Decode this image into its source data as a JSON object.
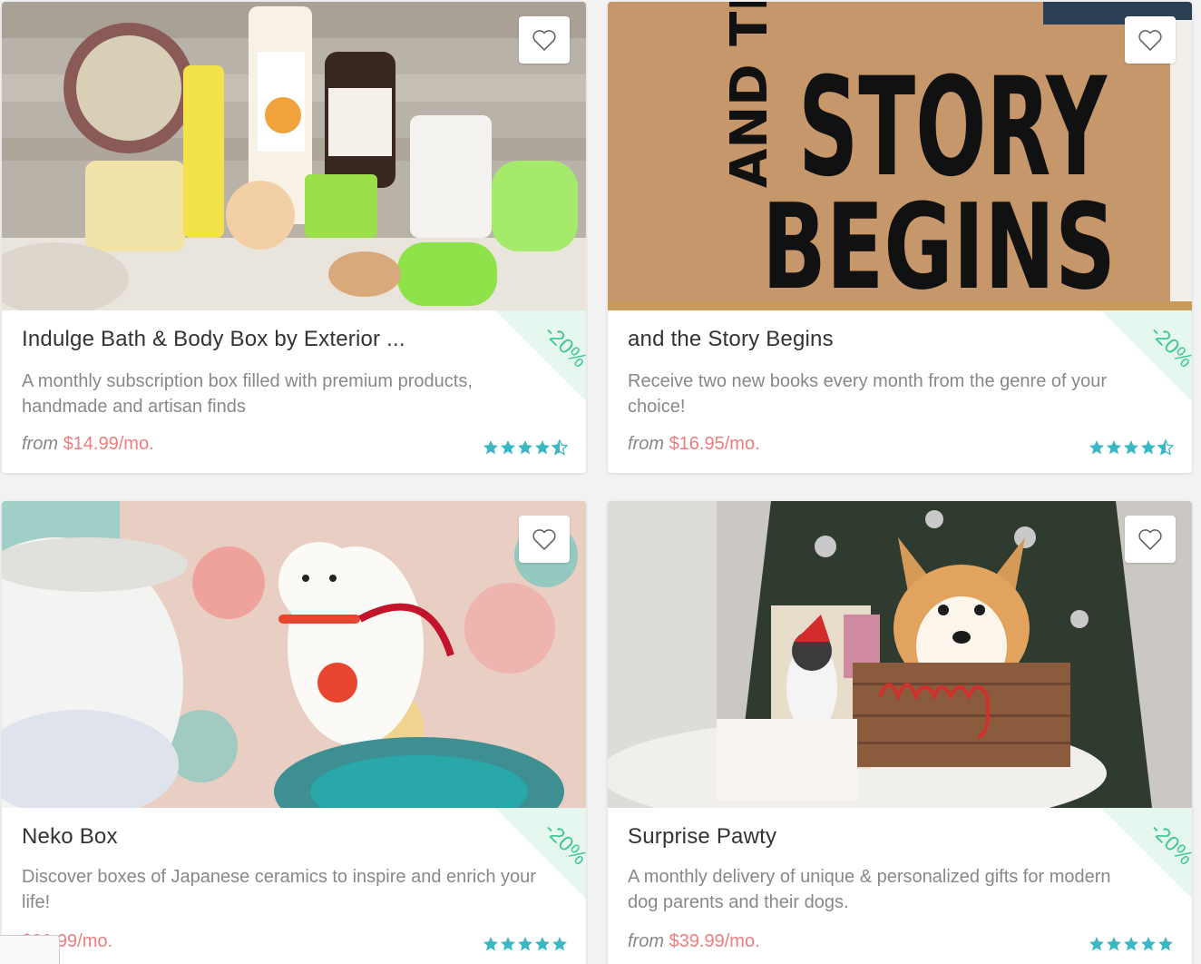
{
  "cards": [
    {
      "title": "Indulge Bath & Body Box by Exterior ...",
      "description": "A monthly subscription box filled with premium products, handmade and artisan finds",
      "price_prefix": "from",
      "price": "$14.99",
      "price_suffix": "/mo.",
      "discount": "-20%",
      "rating": 4.5,
      "image": "bath-products-photo",
      "favorite_icon": "heart-outline-icon"
    },
    {
      "title": "and the Story Begins",
      "description": "Receive two new books every month from the genre of your choice!",
      "price_prefix": "from",
      "price": "$16.95",
      "price_suffix": "/mo.",
      "discount": "-20%",
      "rating": 4.5,
      "image": "story-begins-box-photo",
      "favorite_icon": "heart-outline-icon"
    },
    {
      "title": "Neko Box",
      "description": "Discover boxes of Japanese ceramics to inspire and enrich your life!",
      "price_prefix": "",
      "price": "$39.99",
      "price_suffix": "/mo.",
      "discount": "-20%",
      "rating": 5,
      "image": "lucky-cat-ceramics-photo",
      "favorite_icon": "heart-outline-icon"
    },
    {
      "title": "Surprise Pawty",
      "description": "A monthly delivery of unique & personalized gifts for modern dog parents and their dogs.",
      "price_prefix": "from",
      "price": "$39.99",
      "price_suffix": "/mo.",
      "discount": "-20%",
      "rating": 5,
      "image": "corgi-gift-box-photo",
      "favorite_icon": "heart-outline-icon"
    }
  ],
  "colors": {
    "price": "#f07d7d",
    "stars": "#3bb7c4",
    "discount": "#3cc98d",
    "discount_bg": "#e6f7ef"
  }
}
